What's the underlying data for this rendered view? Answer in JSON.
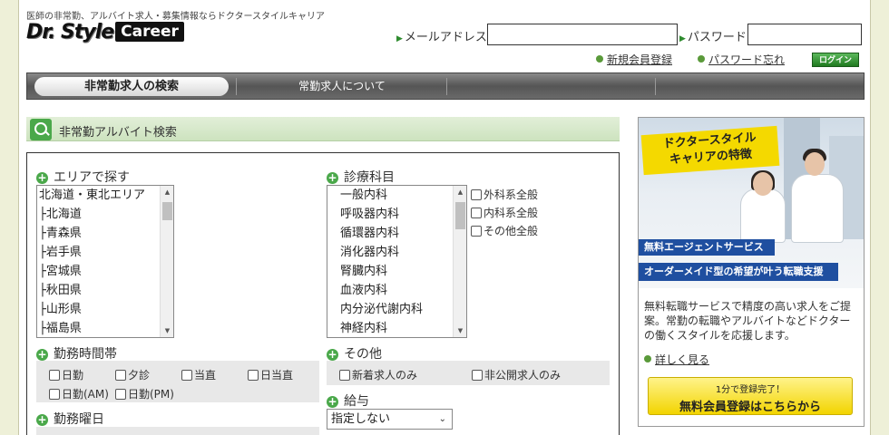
{
  "header": {
    "tagline": "医師の非常勤、アルバイト求人・募集情報ならドクタースタイルキャリア",
    "logo_dr": "Dr. Style",
    "logo_career": "Career",
    "email_label": "メールアドレス",
    "password_label": "パスワード",
    "register_link": "新規会員登録",
    "forgot_link": "パスワード忘れ",
    "login_button": "ログイン"
  },
  "nav": {
    "items": [
      {
        "label": "非常勤求人の検索"
      },
      {
        "label": "常勤求人について"
      }
    ]
  },
  "search": {
    "title": "非常勤アルバイト検索",
    "area": {
      "heading": "エリアで探す",
      "options": [
        "北海道・東北エリア",
        "├北海道",
        "├青森県",
        "├岩手県",
        "├宮城県",
        "├秋田県",
        "├山形県",
        "├福島県"
      ]
    },
    "specialty": {
      "heading": "診療科目",
      "options": [
        "一般内科",
        "呼吸器内科",
        "循環器内科",
        "消化器内科",
        "腎臓内科",
        "血液内科",
        "内分泌代謝内科",
        "神経内科"
      ],
      "checks": [
        "外科系全般",
        "内科系全般",
        "その他全般"
      ]
    },
    "hours": {
      "heading": "勤務時間帯",
      "options": [
        "日勤",
        "夕診",
        "当直",
        "日当直",
        "日勤(AM)",
        "日勤(PM)"
      ]
    },
    "other": {
      "heading": "その他",
      "options": [
        "新着求人のみ",
        "非公開求人のみ"
      ]
    },
    "salary": {
      "heading": "給与",
      "selected": "指定しない"
    },
    "weekday": {
      "heading": "勤務曜日"
    }
  },
  "sidebar": {
    "banner_title_1": "ドクタースタイル",
    "banner_title_2": "キャリアの特徴",
    "ribbon_1": "無料エージェントサービス",
    "ribbon_2": "オーダーメイド型の希望が叶う転職支援",
    "description": "無料転職サービスで精度の高い求人をご提案。常勤の転職やアルバイトなどドクターの働くスタイルを応援します。",
    "more_link": "詳しく見る",
    "cta_small": "1分で登録完了！",
    "cta_big": "無料会員登録はこちらから"
  },
  "colors": {
    "accent_green": "#4aa84a",
    "nav_gray": "#555555",
    "cta_yellow": "#f2d400",
    "ribbon_blue": "#1f4fa0"
  }
}
